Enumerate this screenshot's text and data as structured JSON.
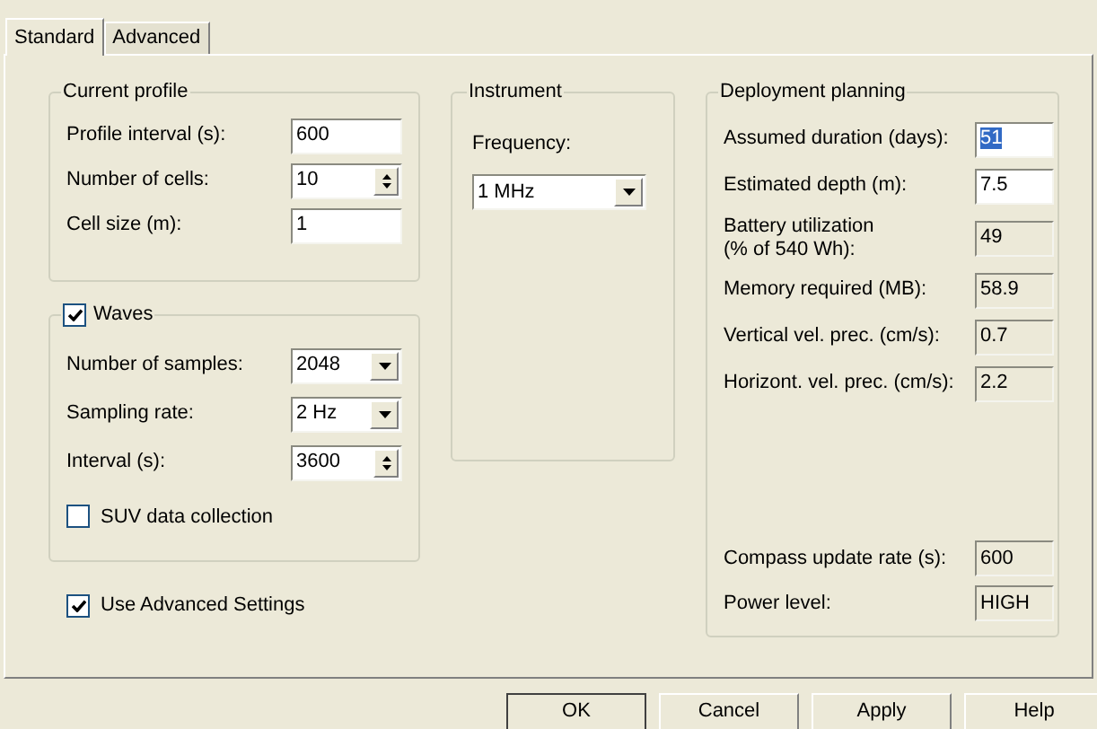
{
  "tabs": [
    {
      "label": "Standard",
      "selected": true
    },
    {
      "label": "Advanced",
      "selected": false
    }
  ],
  "current_profile": {
    "title": "Current profile",
    "fields": [
      {
        "label": "Profile interval (s):",
        "kind": "text",
        "value": "600"
      },
      {
        "label": "Number of cells:",
        "kind": "spin",
        "value": "10"
      },
      {
        "label": "Cell size (m):",
        "kind": "text",
        "value": "1"
      }
    ]
  },
  "waves": {
    "title": "Waves",
    "checked": true,
    "fields": [
      {
        "label": "Number of samples:",
        "kind": "dropdown",
        "value": "2048"
      },
      {
        "label": "Sampling rate:",
        "kind": "dropdown",
        "value": "2 Hz"
      },
      {
        "label": "Interval (s):",
        "kind": "spin",
        "value": "3600"
      }
    ],
    "suv": {
      "label": "SUV data collection",
      "checked": false
    }
  },
  "use_advanced": {
    "label": "Use Advanced Settings",
    "checked": true
  },
  "instrument": {
    "title": "Instrument",
    "fields": [
      {
        "label": "Frequency:",
        "kind": "dropdown",
        "value": "1 MHz"
      }
    ]
  },
  "deployment": {
    "title": "Deployment planning",
    "fields": [
      {
        "label": "Assumed duration (days):",
        "kind": "text",
        "value": "51",
        "highlighted": true
      },
      {
        "label": "Estimated depth (m):",
        "kind": "text",
        "value": "7.5",
        "highlighted": false
      },
      {
        "label": "Battery utilization\n(% of 540 Wh):",
        "kind": "readonly",
        "value": "49",
        "highlighted": false
      },
      {
        "label": "Memory required (MB):",
        "kind": "readonly",
        "value": "58.9",
        "highlighted": false
      },
      {
        "label": "Vertical vel. prec. (cm/s):",
        "kind": "readonly",
        "value": "0.7",
        "highlighted": false
      },
      {
        "label": "Horizont. vel. prec. (cm/s):",
        "kind": "readonly",
        "value": "2.2",
        "highlighted": false
      }
    ],
    "footer_fields": [
      {
        "label": "Compass update rate (s):",
        "kind": "readonly",
        "value": "600",
        "highlighted": false
      },
      {
        "label": "Power level:",
        "kind": "readonly",
        "value": "HIGH",
        "highlighted": false
      }
    ]
  },
  "buttons": [
    {
      "label": "OK",
      "default": true
    },
    {
      "label": "Cancel",
      "default": false
    },
    {
      "label": "Apply",
      "default": false
    },
    {
      "label": "Help",
      "default": false
    }
  ]
}
